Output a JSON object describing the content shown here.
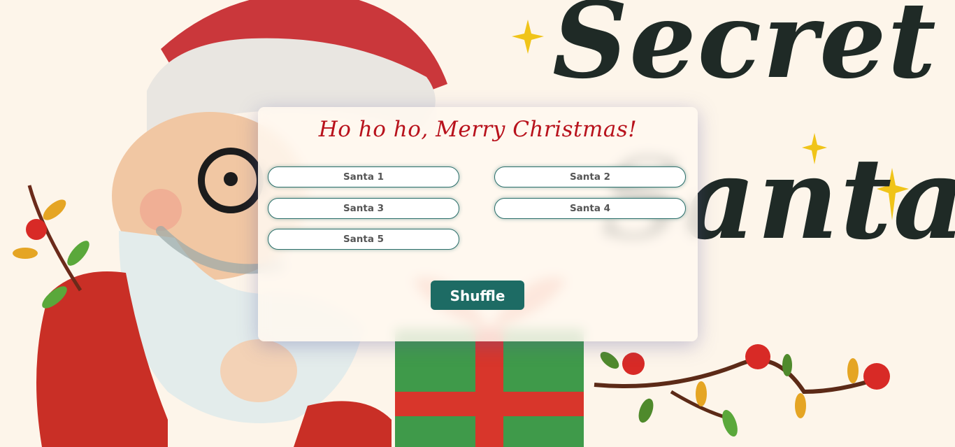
{
  "background": {
    "title_line1": "Secret",
    "title_line2": "Santa"
  },
  "card": {
    "title": "Ho ho ho, Merry Christmas!",
    "santas": [
      "Santa 1",
      "Santa 2",
      "Santa 3",
      "Santa 4",
      "Santa 5"
    ],
    "shuffle_label": "Shuffle"
  },
  "colors": {
    "page_background": "#fdf5ea",
    "title_red": "#b8121c",
    "button_teal": "#1d6b64",
    "field_border": "#2b6f6a"
  },
  "icons": [
    "santa-illustration",
    "gift-box-illustration",
    "berry-garland-illustration",
    "star-icon"
  ]
}
